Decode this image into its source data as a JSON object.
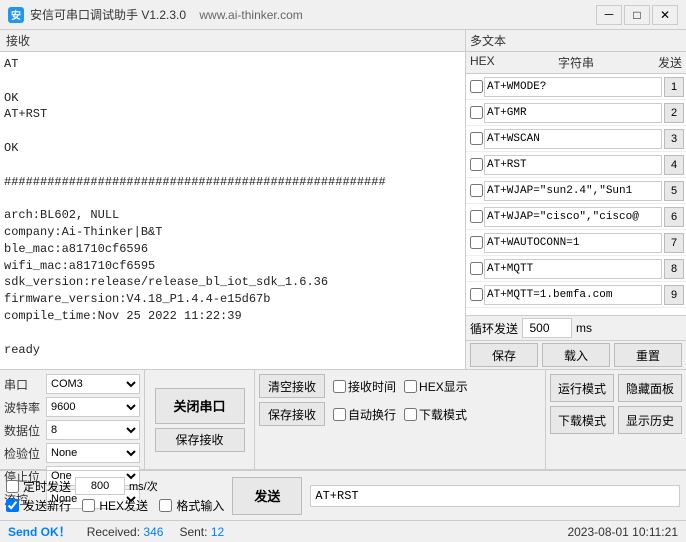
{
  "titlebar": {
    "icon_text": "安",
    "app_name": "安信可串口调试助手 V1.2.3.0",
    "website": "www.ai-thinker.com",
    "min_btn": "－",
    "max_btn": "□",
    "close_btn": "✕"
  },
  "receive_panel": {
    "label": "接收",
    "content": "AT\n\nOK\nAT+RST\n\nOK\n\n#####################################################\n\narch:BL602, NULL\ncompany:Ai-Thinker|B&T\nble_mac:a81710cf6596\nwifi_mac:a81710cf6595\nsdk_version:release/release_bl_iot_sdk_1.6.36\nfirmware_version:V4.18_P1.4.4-e15d67b\ncompile_time:Nov 25 2022 11:22:39\n\nready\n\n#####################################################"
  },
  "multitext": {
    "title": "多文本",
    "col_hex": "HEX",
    "col_str": "字符串",
    "col_send": "发送",
    "rows": [
      {
        "hex": false,
        "value": "AT+WMODE?",
        "send_num": "1"
      },
      {
        "hex": false,
        "value": "AT+GMR",
        "send_num": "2"
      },
      {
        "hex": false,
        "value": "AT+WSCAN",
        "send_num": "3"
      },
      {
        "hex": false,
        "value": "AT+RST",
        "send_num": "4"
      },
      {
        "hex": false,
        "value": "AT+WJAP=\"sun2.4\",\"Sun1",
        "send_num": "5"
      },
      {
        "hex": false,
        "value": "AT+WJAP=\"cisco\",\"cisco@",
        "send_num": "6"
      },
      {
        "hex": false,
        "value": "AT+WAUTOCONN=1",
        "send_num": "7"
      },
      {
        "hex": false,
        "value": "AT+MQTT",
        "send_num": "8"
      },
      {
        "hex": false,
        "value": "AT+MQTT=1.bemfa.com",
        "send_num": "9"
      }
    ],
    "cycle_label": "循环发送",
    "cycle_value": "500",
    "cycle_unit": "ms",
    "save_btn": "保存",
    "load_btn": "载入",
    "reset_btn": "重置"
  },
  "serial_settings": {
    "label": "串口",
    "port_label": "串口",
    "port_value": "COM3",
    "baud_label": "波特率",
    "baud_value": "9600",
    "data_label": "数据位",
    "data_value": "8",
    "parity_label": "检验位",
    "parity_value": "None",
    "stop_label": "停止位",
    "stop_value": "One",
    "flow_label": "流控",
    "flow_value": "None"
  },
  "open_close": {
    "btn_label": "关闭串口",
    "save_recv_label": "保存接收"
  },
  "recv_options": {
    "clear_btn": "清空接收",
    "save_btn": "保存接收",
    "time_label": "接收时间",
    "hex_label": "HEX显示",
    "auto_label": "自动换行",
    "download_label": "下载模式"
  },
  "right_buttons": {
    "run_mode": "运行模式",
    "hide_panel": "隐藏面板",
    "dl_mode": "下载模式",
    "show_history": "显示历史"
  },
  "send_area": {
    "timed_label": "定时发送",
    "timed_value": "800",
    "timed_unit": "ms/次",
    "newline_label": "发送新行",
    "newline_checked": true,
    "hex_send_label": "HEX发送",
    "hex_send_checked": false,
    "fmt_input_label": "格式输入",
    "fmt_input_checked": false,
    "send_btn": "发送",
    "send_input_value": "AT+RST"
  },
  "status_bar": {
    "send_ok": "Send OK！",
    "received_label": "Received:",
    "received_value": "346",
    "sent_label": "Sent:",
    "sent_value": "12",
    "datetime": "2023-08-01  10:11:21"
  }
}
